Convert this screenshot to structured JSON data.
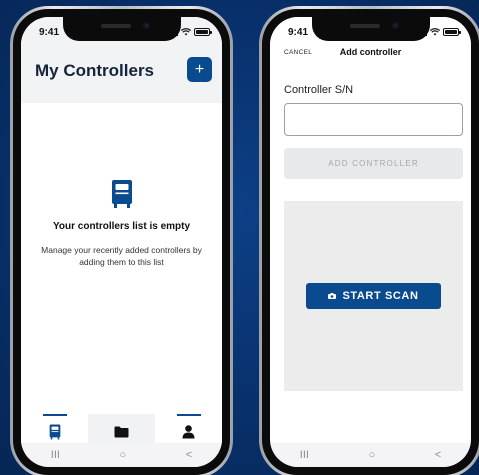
{
  "phone1": {
    "status": {
      "time": "9:41"
    },
    "header": {
      "title": "My Controllers",
      "add_button": "+"
    },
    "empty": {
      "icon": "controller-icon",
      "title": "Your controllers list is empty",
      "description": "Manage your recently added controllers by adding them to this list"
    },
    "tabs": [
      {
        "name": "controllers",
        "icon": "controller-icon",
        "active": true
      },
      {
        "name": "files",
        "icon": "folder-icon",
        "active": false
      },
      {
        "name": "profile",
        "icon": "person-icon",
        "active": false
      }
    ],
    "nav": {
      "recents": "III",
      "home": "○",
      "back": "<"
    }
  },
  "phone2": {
    "status": {
      "time": "9:41"
    },
    "header": {
      "cancel": "CANCEL",
      "title": "Add controller"
    },
    "form": {
      "label": "Controller S/N",
      "input_value": "",
      "add_button": "ADD CONTROLLER"
    },
    "scan": {
      "button": "START SCAN",
      "icon": "camera-icon"
    },
    "nav": {
      "recents": "III",
      "home": "○",
      "back": "<"
    }
  },
  "colors": {
    "background": "#08306b",
    "accent": "#0a4a8f",
    "disabled_button": "#e8e9eb",
    "scan_area": "#ececed"
  }
}
